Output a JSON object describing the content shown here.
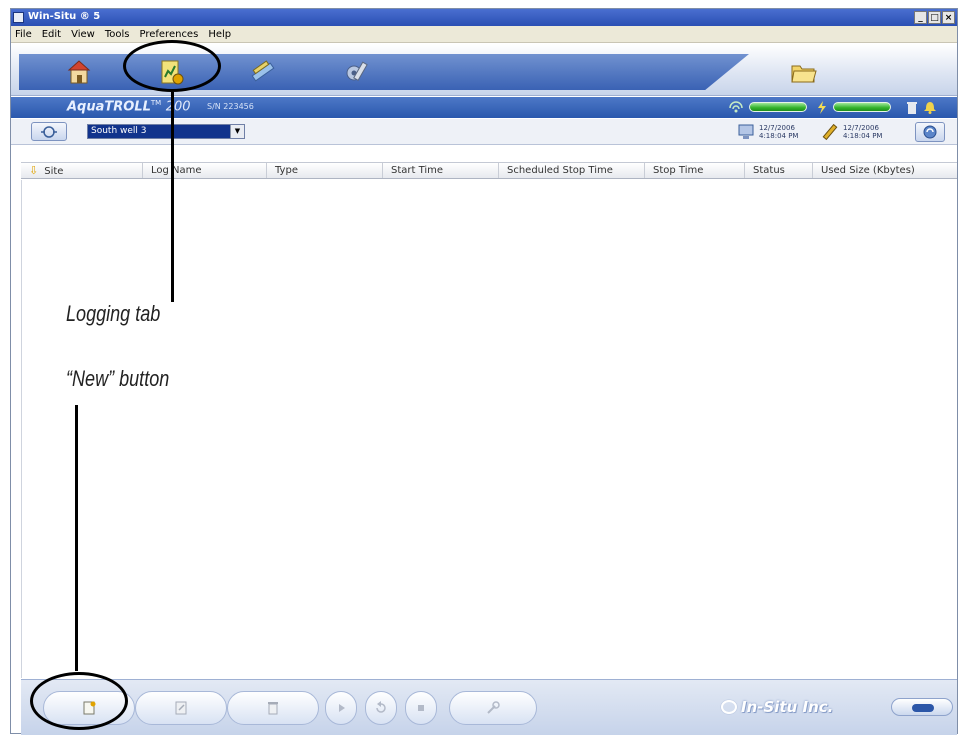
{
  "window": {
    "title": "Win-Situ ® 5",
    "controls": [
      "_",
      "□",
      "×"
    ]
  },
  "menu": [
    "File",
    "Edit",
    "View",
    "Tools",
    "Preferences",
    "Help"
  ],
  "tabs": [
    {
      "name": "home-tab",
      "icon": "home-icon"
    },
    {
      "name": "logging-tab",
      "icon": "logging-icon"
    },
    {
      "name": "calibration-tab",
      "icon": "calibration-icon"
    },
    {
      "name": "utilities-tab",
      "icon": "utilities-icon"
    },
    {
      "name": "open-folder-tab",
      "icon": "folder-icon"
    }
  ],
  "device": {
    "brand": "Aqua",
    "line": "TROLL",
    "trademark": "TM",
    "model": "200",
    "serial": "S/N 223456",
    "signal_level": 1.0,
    "battery_level": 1.0
  },
  "selector": {
    "value": "South well 3"
  },
  "pc_time": {
    "date": "12/7/2006",
    "time": "4:18:04 PM"
  },
  "device_time": {
    "date": "12/7/2006",
    "time": "4:18:04 PM"
  },
  "table": {
    "columns": [
      "Site",
      "Log Name",
      "Type",
      "Start Time",
      "Scheduled Stop Time",
      "Stop Time",
      "Status",
      "Used Size (Kbytes)"
    ],
    "rows": []
  },
  "bottom_buttons": [
    {
      "name": "new-button",
      "icon": "new-log-icon"
    },
    {
      "name": "edit-button",
      "icon": "edit-icon"
    },
    {
      "name": "delete-button",
      "icon": "delete-icon"
    },
    {
      "name": "start-button",
      "icon": "play-icon"
    },
    {
      "name": "download-button",
      "icon": "download-icon"
    },
    {
      "name": "stop-button",
      "icon": "stop-icon"
    },
    {
      "name": "setup-button",
      "icon": "wrench-icon"
    }
  ],
  "company": "In-Situ Inc.",
  "annotations": {
    "logging_tab": "Logging tab",
    "new_button": "“New” button"
  },
  "colors": {
    "titlebar": "#2a4fb3",
    "device_header": "#2a58ad",
    "meter_green": "#31b12a",
    "selector_bg": "#11338c",
    "sort_arrow": "#e0a300"
  }
}
